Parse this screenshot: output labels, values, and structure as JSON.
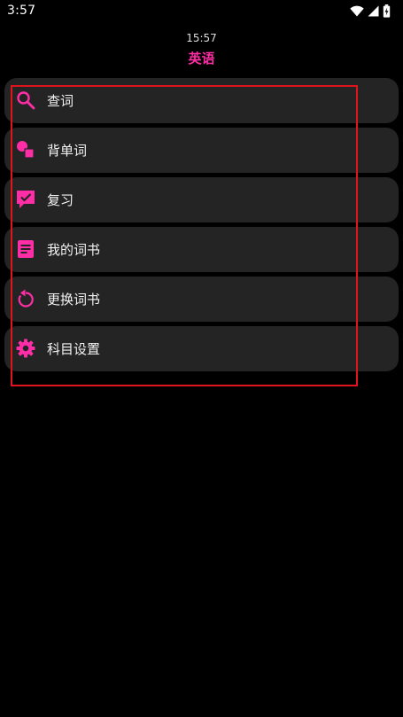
{
  "status_bar": {
    "time": "3:57",
    "icons": [
      "wifi-icon",
      "signal-icon",
      "battery-icon"
    ]
  },
  "header": {
    "time": "15:57",
    "title": "英语"
  },
  "colors": {
    "accent": "#ff2da6",
    "item_bg": "#242424",
    "highlight": "#e0141c"
  },
  "menu": {
    "items": [
      {
        "label": "查词",
        "icon": "search-icon"
      },
      {
        "label": "背单词",
        "icon": "shapes-icon"
      },
      {
        "label": "复习",
        "icon": "check-chat-icon"
      },
      {
        "label": "我的词书",
        "icon": "notebook-icon"
      },
      {
        "label": "更换词书",
        "icon": "refresh-icon"
      },
      {
        "label": "科目设置",
        "icon": "gear-icon"
      }
    ]
  }
}
